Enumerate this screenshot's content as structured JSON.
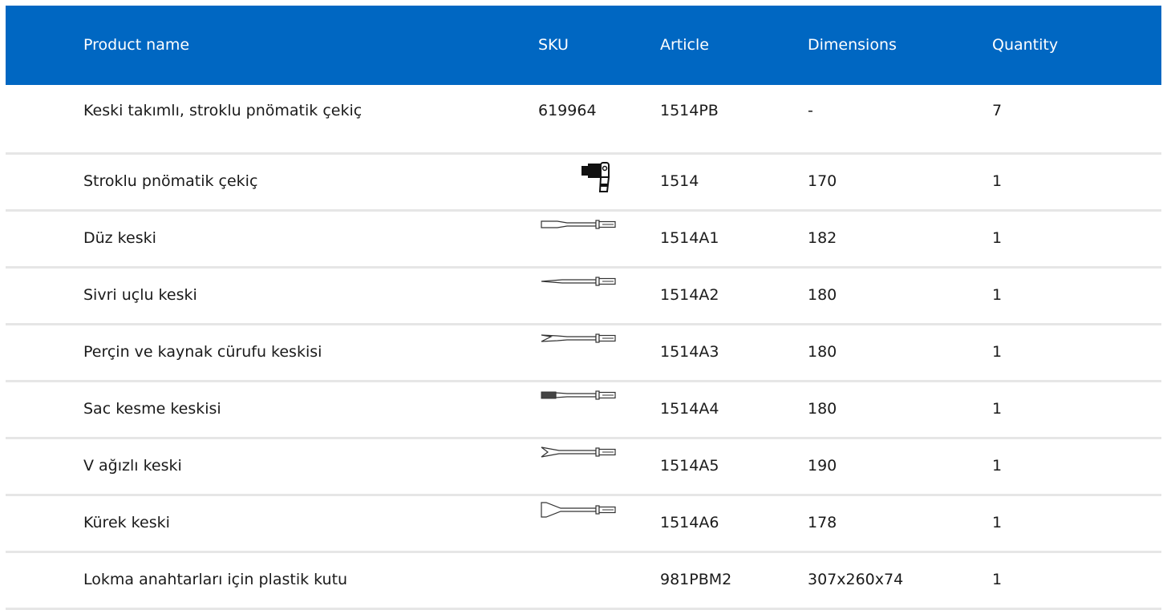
{
  "table": {
    "headers": {
      "name": "Product name",
      "sku": "SKU",
      "article": "Article",
      "dimensions": "Dimensions",
      "quantity": "Quantity"
    },
    "rows": [
      {
        "name": "Keski takımlı, stroklu pnömatik çekiç",
        "sku": "619964",
        "article": "1514PB",
        "dimensions": "-",
        "quantity": "7",
        "icon": ""
      },
      {
        "name": "Stroklu pnömatik çekiç",
        "sku": "",
        "article": "1514",
        "dimensions": "170",
        "quantity": "1",
        "icon": "pneumatic-hammer-icon"
      },
      {
        "name": "Düz keski",
        "sku": "",
        "article": "1514A1",
        "dimensions": "182",
        "quantity": "1",
        "icon": "flat-chisel-icon"
      },
      {
        "name": "Sivri uçlu keski",
        "sku": "",
        "article": "1514A2",
        "dimensions": "180",
        "quantity": "1",
        "icon": "pointed-chisel-icon"
      },
      {
        "name": "Perçin ve kaynak cürufu keskisi",
        "sku": "",
        "article": "1514A3",
        "dimensions": "180",
        "quantity": "1",
        "icon": "rivet-chisel-icon"
      },
      {
        "name": "Sac kesme keskisi",
        "sku": "",
        "article": "1514A4",
        "dimensions": "180",
        "quantity": "1",
        "icon": "sheet-cutting-chisel-icon"
      },
      {
        "name": "V ağızlı keski",
        "sku": "",
        "article": "1514A5",
        "dimensions": "190",
        "quantity": "1",
        "icon": "v-chisel-icon"
      },
      {
        "name": "Kürek keski",
        "sku": "",
        "article": "1514A6",
        "dimensions": "178",
        "quantity": "1",
        "icon": "shovel-chisel-icon"
      },
      {
        "name": "Lokma anahtarları için plastik kutu",
        "sku": "",
        "article": "981PBM2",
        "dimensions": "307x260x74",
        "quantity": "1",
        "icon": ""
      }
    ],
    "colors": {
      "header_bg": "#0067c2",
      "header_text": "#ffffff",
      "row_divider": "#e6e6e6"
    }
  }
}
